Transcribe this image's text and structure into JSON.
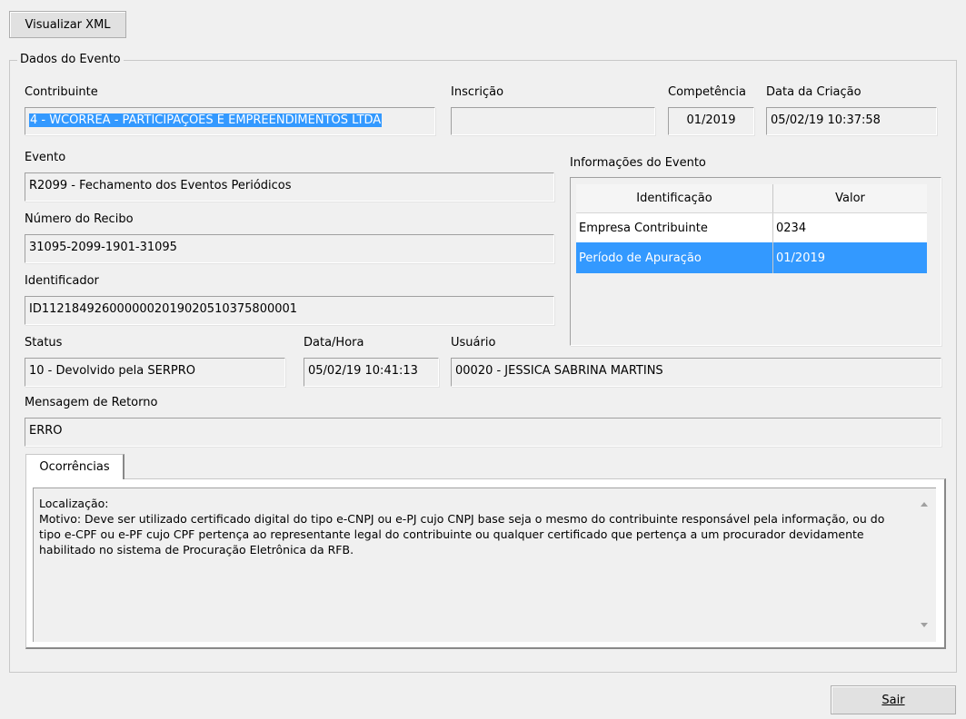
{
  "toolbar": {
    "view_xml_label": "Visualizar XML"
  },
  "group": {
    "title": "Dados do Evento"
  },
  "fields": {
    "contribuinte": {
      "label": "Contribuinte",
      "value": "4 - WCORREA - PARTICIPAÇOES E EMPREENDIMENTOS LTDA"
    },
    "inscricao": {
      "label": "Inscrição",
      "value": ""
    },
    "competencia": {
      "label": "Competência",
      "value": "01/2019"
    },
    "data_criacao": {
      "label": "Data da Criação",
      "value": "05/02/19 10:37:58"
    },
    "evento": {
      "label": "Evento",
      "value": "R2099 - Fechamento dos Eventos Periódicos"
    },
    "numero_recibo": {
      "label": "Número do Recibo",
      "value": "31095-2099-1901-31095"
    },
    "identificador": {
      "label": "Identificador",
      "value": "ID1121849260000002019020510375800001"
    },
    "status": {
      "label": "Status",
      "value": "10 - Devolvido pela SERPRO"
    },
    "data_hora": {
      "label": "Data/Hora",
      "value": "05/02/19 10:41:13"
    },
    "usuario": {
      "label": "Usuário",
      "value": "00020 - JESSICA SABRINA MARTINS"
    },
    "mensagem_retorno": {
      "label": "Mensagem de Retorno",
      "value": "ERRO"
    }
  },
  "info": {
    "title": "Informações do Evento",
    "columns": [
      "Identificação",
      "Valor"
    ],
    "rows": [
      {
        "id": "Empresa Contribuinte",
        "valor": "0234"
      },
      {
        "id": "Período de Apuração",
        "valor": "01/2019"
      }
    ]
  },
  "tabs": [
    {
      "label": "Ocorrências"
    }
  ],
  "ocorrencias": {
    "line1": "Localização:",
    "line2": "Motivo: Deve ser utilizado certificado digital do tipo e-CNPJ ou e-PJ cujo CNPJ base seja o mesmo do contribuinte responsável pela informação, ou do tipo e-CPF ou e-PF cujo CPF pertença ao representante legal do contribuinte ou qualquer certificado que pertença a um procurador devidamente habilitado no sistema de Procuração Eletrônica da RFB."
  },
  "footer": {
    "exit_label": "Sair"
  }
}
